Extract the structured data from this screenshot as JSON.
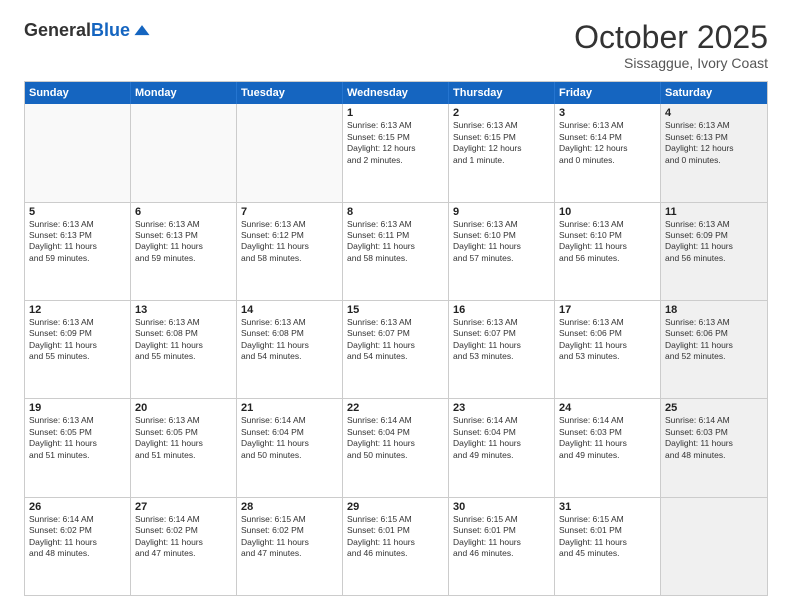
{
  "logo": {
    "general": "General",
    "blue": "Blue"
  },
  "header": {
    "month": "October 2025",
    "location": "Sissaggue, Ivory Coast"
  },
  "weekdays": [
    "Sunday",
    "Monday",
    "Tuesday",
    "Wednesday",
    "Thursday",
    "Friday",
    "Saturday"
  ],
  "rows": [
    [
      {
        "day": "",
        "info": "",
        "empty": true
      },
      {
        "day": "",
        "info": "",
        "empty": true
      },
      {
        "day": "",
        "info": "",
        "empty": true
      },
      {
        "day": "1",
        "info": "Sunrise: 6:13 AM\nSunset: 6:15 PM\nDaylight: 12 hours\nand 2 minutes."
      },
      {
        "day": "2",
        "info": "Sunrise: 6:13 AM\nSunset: 6:15 PM\nDaylight: 12 hours\nand 1 minute."
      },
      {
        "day": "3",
        "info": "Sunrise: 6:13 AM\nSunset: 6:14 PM\nDaylight: 12 hours\nand 0 minutes."
      },
      {
        "day": "4",
        "info": "Sunrise: 6:13 AM\nSunset: 6:13 PM\nDaylight: 12 hours\nand 0 minutes.",
        "shaded": true
      }
    ],
    [
      {
        "day": "5",
        "info": "Sunrise: 6:13 AM\nSunset: 6:13 PM\nDaylight: 11 hours\nand 59 minutes."
      },
      {
        "day": "6",
        "info": "Sunrise: 6:13 AM\nSunset: 6:13 PM\nDaylight: 11 hours\nand 59 minutes."
      },
      {
        "day": "7",
        "info": "Sunrise: 6:13 AM\nSunset: 6:12 PM\nDaylight: 11 hours\nand 58 minutes."
      },
      {
        "day": "8",
        "info": "Sunrise: 6:13 AM\nSunset: 6:11 PM\nDaylight: 11 hours\nand 58 minutes."
      },
      {
        "day": "9",
        "info": "Sunrise: 6:13 AM\nSunset: 6:10 PM\nDaylight: 11 hours\nand 57 minutes."
      },
      {
        "day": "10",
        "info": "Sunrise: 6:13 AM\nSunset: 6:10 PM\nDaylight: 11 hours\nand 56 minutes."
      },
      {
        "day": "11",
        "info": "Sunrise: 6:13 AM\nSunset: 6:09 PM\nDaylight: 11 hours\nand 56 minutes.",
        "shaded": true
      }
    ],
    [
      {
        "day": "12",
        "info": "Sunrise: 6:13 AM\nSunset: 6:09 PM\nDaylight: 11 hours\nand 55 minutes."
      },
      {
        "day": "13",
        "info": "Sunrise: 6:13 AM\nSunset: 6:08 PM\nDaylight: 11 hours\nand 55 minutes."
      },
      {
        "day": "14",
        "info": "Sunrise: 6:13 AM\nSunset: 6:08 PM\nDaylight: 11 hours\nand 54 minutes."
      },
      {
        "day": "15",
        "info": "Sunrise: 6:13 AM\nSunset: 6:07 PM\nDaylight: 11 hours\nand 54 minutes."
      },
      {
        "day": "16",
        "info": "Sunrise: 6:13 AM\nSunset: 6:07 PM\nDaylight: 11 hours\nand 53 minutes."
      },
      {
        "day": "17",
        "info": "Sunrise: 6:13 AM\nSunset: 6:06 PM\nDaylight: 11 hours\nand 53 minutes."
      },
      {
        "day": "18",
        "info": "Sunrise: 6:13 AM\nSunset: 6:06 PM\nDaylight: 11 hours\nand 52 minutes.",
        "shaded": true
      }
    ],
    [
      {
        "day": "19",
        "info": "Sunrise: 6:13 AM\nSunset: 6:05 PM\nDaylight: 11 hours\nand 51 minutes."
      },
      {
        "day": "20",
        "info": "Sunrise: 6:13 AM\nSunset: 6:05 PM\nDaylight: 11 hours\nand 51 minutes."
      },
      {
        "day": "21",
        "info": "Sunrise: 6:14 AM\nSunset: 6:04 PM\nDaylight: 11 hours\nand 50 minutes."
      },
      {
        "day": "22",
        "info": "Sunrise: 6:14 AM\nSunset: 6:04 PM\nDaylight: 11 hours\nand 50 minutes."
      },
      {
        "day": "23",
        "info": "Sunrise: 6:14 AM\nSunset: 6:04 PM\nDaylight: 11 hours\nand 49 minutes."
      },
      {
        "day": "24",
        "info": "Sunrise: 6:14 AM\nSunset: 6:03 PM\nDaylight: 11 hours\nand 49 minutes."
      },
      {
        "day": "25",
        "info": "Sunrise: 6:14 AM\nSunset: 6:03 PM\nDaylight: 11 hours\nand 48 minutes.",
        "shaded": true
      }
    ],
    [
      {
        "day": "26",
        "info": "Sunrise: 6:14 AM\nSunset: 6:02 PM\nDaylight: 11 hours\nand 48 minutes."
      },
      {
        "day": "27",
        "info": "Sunrise: 6:14 AM\nSunset: 6:02 PM\nDaylight: 11 hours\nand 47 minutes."
      },
      {
        "day": "28",
        "info": "Sunrise: 6:15 AM\nSunset: 6:02 PM\nDaylight: 11 hours\nand 47 minutes."
      },
      {
        "day": "29",
        "info": "Sunrise: 6:15 AM\nSunset: 6:01 PM\nDaylight: 11 hours\nand 46 minutes."
      },
      {
        "day": "30",
        "info": "Sunrise: 6:15 AM\nSunset: 6:01 PM\nDaylight: 11 hours\nand 46 minutes."
      },
      {
        "day": "31",
        "info": "Sunrise: 6:15 AM\nSunset: 6:01 PM\nDaylight: 11 hours\nand 45 minutes."
      },
      {
        "day": "",
        "info": "",
        "empty": true,
        "shaded": true
      }
    ]
  ]
}
